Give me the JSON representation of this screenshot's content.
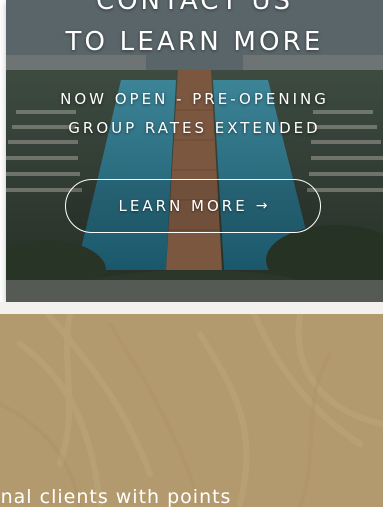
{
  "hero": {
    "heading_line1": "CONTACT US",
    "heading_line2": "TO LEARN MORE",
    "subheading_line1": "NOW OPEN - PRE-OPENING",
    "subheading_line2": "GROUP RATES EXTENDED",
    "button_label": "LEARN MORE",
    "button_icon": "arrow-right-icon",
    "button_arrow": "→"
  },
  "section": {
    "body_text": "onal clients with points",
    "background_color": "#b39a6e"
  },
  "colors": {
    "text": "#ffffff",
    "overlay": "#0f161e",
    "tan": "#b39a6e",
    "pool": "#2f7f95"
  }
}
